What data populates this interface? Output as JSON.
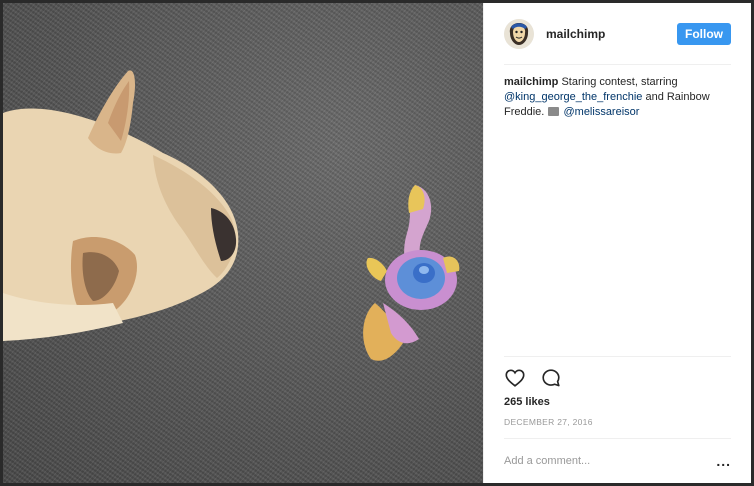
{
  "post": {
    "username": "mailchimp",
    "follow_label": "Follow",
    "caption": {
      "username": "mailchimp",
      "text_1": "Staring contest, starring",
      "mention_1": "@king_george_the_frenchie",
      "text_2": "and Rainbow Freddie.",
      "mention_2": "@melissareisor"
    },
    "likes": "265 likes",
    "date": "DECEMBER 27, 2016",
    "comment_placeholder": "Add a comment...",
    "more_label": "..."
  },
  "icons": {
    "like": "heart-icon",
    "comment": "comment-bubble-icon",
    "avatar": "mailchimp-freddie-avatar",
    "camera": "camera-emoji-icon"
  },
  "colors": {
    "follow_button": "#3897f0",
    "mention_link": "#003569",
    "muted_text": "#999999"
  }
}
